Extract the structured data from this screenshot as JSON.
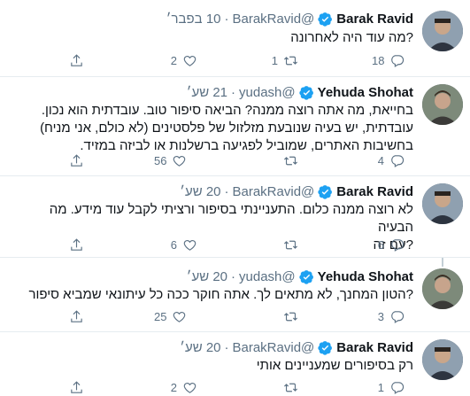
{
  "tweets": [
    {
      "name": "Barak Ravid",
      "handle": "@BarakRavid",
      "time": "10 בפבר׳",
      "lines": [
        "?מה עוד היה לאחרונה"
      ],
      "reply_count": "18",
      "retweet_count": "1",
      "like_count": "2"
    },
    {
      "name": "Yehuda Shohat",
      "handle": "@yudash",
      "time": "21 שע׳",
      "lines": [
        "בחייאת, מה אתה רוצה ממנה? הביאה סיפור טוב. עובדתית הוא נכון.",
        "עובדתית, יש בעיה שנובעת מזלזול של פלסטינים (לא כולם, אני מניח)",
        "בחשיבות האתרים, שמוביל לפגיעה ברשלנות או לביזה במזיד."
      ],
      "reply_count": "4",
      "retweet_count": "",
      "like_count": "56"
    },
    {
      "name": "Barak Ravid",
      "handle": "@BarakRavid",
      "time": "20 שע׳",
      "lines": [
        "לא רוצה ממנה כלום. התעניינתי בסיפור ורציתי לקבל עוד מידע. מה הבעיה",
        "?עם זה"
      ],
      "reply_count": "6",
      "retweet_count": "",
      "like_count": "6"
    },
    {
      "name": "Yehuda Shohat",
      "handle": "@yudash",
      "time": "20 שע׳",
      "lines": [
        "?הטון המחנך, לא מתאים לך. אתה חוקר ככה כל עיתונאי שמביא סיפור"
      ],
      "reply_count": "3",
      "retweet_count": "",
      "like_count": "25"
    },
    {
      "name": "Barak Ravid",
      "handle": "@BarakRavid",
      "time": "20 שע׳",
      "lines": [
        "רק בסיפורים שמעניינים אותי"
      ],
      "reply_count": "1",
      "retweet_count": "",
      "like_count": "2"
    }
  ],
  "icons": {
    "reply": "speech-bubble",
    "retweet": "retweet-arrows",
    "like": "heart",
    "share": "share-upload",
    "verified": "verified-badge"
  },
  "colors": {
    "verified": "#1da1f2",
    "secondary_text": "#5b7083",
    "divider": "#e6ecf0"
  }
}
